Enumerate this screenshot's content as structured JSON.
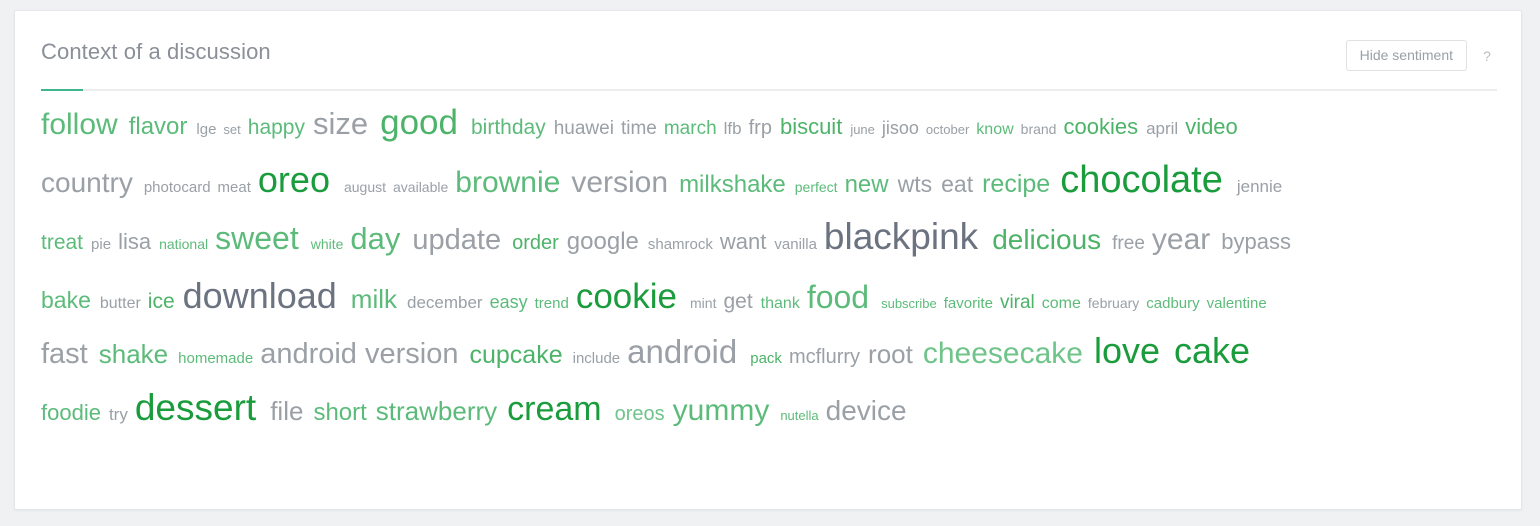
{
  "card": {
    "title": "Context of a discussion",
    "hide_sentiment_label": "Hide sentiment",
    "help_icon": "question-mark-icon",
    "help_label": "?",
    "accent_color": "#3fb68b"
  },
  "legend": {
    "positive_color": "#4caf68",
    "positive_strong_color": "#1a9c3c",
    "neutral_color": "#9aa0a6",
    "neutral_dark_color": "#6b7280"
  },
  "word_cloud": {
    "rows": [
      [
        {
          "text": "follow",
          "size": 30,
          "color": "#5cbb7a"
        },
        {
          "text": "flavor",
          "size": 24,
          "color": "#5cbb7a"
        },
        {
          "text": "lge",
          "size": 15,
          "color": "#9aa0a6"
        },
        {
          "text": "set",
          "size": 13,
          "color": "#9aa0a6"
        },
        {
          "text": "happy",
          "size": 21,
          "color": "#5cbb7a"
        },
        {
          "text": "size",
          "size": 31,
          "color": "#9aa0a6"
        },
        {
          "text": "good",
          "size": 35,
          "color": "#4cb368"
        },
        {
          "text": "birthday",
          "size": 21,
          "color": "#5cbb7a"
        },
        {
          "text": "huawei",
          "size": 19,
          "color": "#9aa0a6"
        },
        {
          "text": "time",
          "size": 19,
          "color": "#9aa0a6"
        },
        {
          "text": "march",
          "size": 19,
          "color": "#5cbb7a"
        },
        {
          "text": "lfb",
          "size": 17,
          "color": "#9aa0a6"
        },
        {
          "text": "frp",
          "size": 20,
          "color": "#9aa0a6"
        },
        {
          "text": "biscuit",
          "size": 22,
          "color": "#4cb368"
        },
        {
          "text": "june",
          "size": 13,
          "color": "#9aa0a6"
        },
        {
          "text": "jisoo",
          "size": 18,
          "color": "#9aa0a6"
        },
        {
          "text": "october",
          "size": 13,
          "color": "#9aa0a6"
        },
        {
          "text": "know",
          "size": 16,
          "color": "#5cbb7a"
        },
        {
          "text": "brand",
          "size": 14,
          "color": "#9aa0a6"
        },
        {
          "text": "cookies",
          "size": 22,
          "color": "#4cb368"
        },
        {
          "text": "april",
          "size": 17,
          "color": "#9aa0a6"
        },
        {
          "text": "video",
          "size": 22,
          "color": "#4cb368"
        }
      ],
      [
        {
          "text": "country",
          "size": 28,
          "color": "#9aa0a6"
        },
        {
          "text": "photocard",
          "size": 15,
          "color": "#9aa0a6"
        },
        {
          "text": "meat",
          "size": 15,
          "color": "#9aa0a6"
        },
        {
          "text": "oreo",
          "size": 36,
          "color": "#1a9c3c"
        },
        {
          "text": "august",
          "size": 14,
          "color": "#9aa0a6"
        },
        {
          "text": "available",
          "size": 14,
          "color": "#9aa0a6"
        },
        {
          "text": "brownie",
          "size": 30,
          "color": "#5cbb7a"
        },
        {
          "text": "version",
          "size": 30,
          "color": "#9aa0a6"
        },
        {
          "text": "milkshake",
          "size": 24,
          "color": "#5cbb7a"
        },
        {
          "text": "perfect",
          "size": 14,
          "color": "#5cbb7a"
        },
        {
          "text": "new",
          "size": 24,
          "color": "#5cbb7a"
        },
        {
          "text": "wts",
          "size": 23,
          "color": "#9aa0a6"
        },
        {
          "text": "eat",
          "size": 23,
          "color": "#9aa0a6"
        },
        {
          "text": "recipe",
          "size": 25,
          "color": "#5cbb7a"
        },
        {
          "text": "chocolate",
          "size": 38,
          "color": "#1a9c3c"
        },
        {
          "text": "jennie",
          "size": 17,
          "color": "#9aa0a6"
        }
      ],
      [
        {
          "text": "treat",
          "size": 21,
          "color": "#5cbb7a"
        },
        {
          "text": "pie",
          "size": 15,
          "color": "#9aa0a6"
        },
        {
          "text": "lisa",
          "size": 22,
          "color": "#9aa0a6"
        },
        {
          "text": "national",
          "size": 14,
          "color": "#5cbb7a"
        },
        {
          "text": "sweet",
          "size": 32,
          "color": "#5cbb7a"
        },
        {
          "text": "white",
          "size": 14,
          "color": "#5cbb7a"
        },
        {
          "text": "day",
          "size": 31,
          "color": "#5cbb7a"
        },
        {
          "text": "update",
          "size": 29,
          "color": "#9aa0a6"
        },
        {
          "text": "order",
          "size": 20,
          "color": "#4cb368"
        },
        {
          "text": "google",
          "size": 24,
          "color": "#9aa0a6"
        },
        {
          "text": "shamrock",
          "size": 15,
          "color": "#9aa0a6"
        },
        {
          "text": "want",
          "size": 22,
          "color": "#9aa0a6"
        },
        {
          "text": "vanilla",
          "size": 15,
          "color": "#9aa0a6"
        },
        {
          "text": "blackpink",
          "size": 37,
          "color": "#6b7280"
        },
        {
          "text": "delicious",
          "size": 28,
          "color": "#4cb368"
        },
        {
          "text": "free",
          "size": 19,
          "color": "#9aa0a6"
        },
        {
          "text": "year",
          "size": 30,
          "color": "#9aa0a6"
        },
        {
          "text": "bypass",
          "size": 22,
          "color": "#9aa0a6"
        }
      ],
      [
        {
          "text": "bake",
          "size": 23,
          "color": "#5cbb7a"
        },
        {
          "text": "butter",
          "size": 16,
          "color": "#9aa0a6"
        },
        {
          "text": "ice",
          "size": 21,
          "color": "#4cb368"
        },
        {
          "text": "download",
          "size": 36,
          "color": "#6b7280"
        },
        {
          "text": "milk",
          "size": 26,
          "color": "#5cbb7a"
        },
        {
          "text": "december",
          "size": 17,
          "color": "#9aa0a6"
        },
        {
          "text": "easy",
          "size": 18,
          "color": "#5cbb7a"
        },
        {
          "text": "trend",
          "size": 15,
          "color": "#5cbb7a"
        },
        {
          "text": "cookie",
          "size": 35,
          "color": "#1a9c3c"
        },
        {
          "text": "mint",
          "size": 14,
          "color": "#9aa0a6"
        },
        {
          "text": "get",
          "size": 21,
          "color": "#9aa0a6"
        },
        {
          "text": "thank",
          "size": 16,
          "color": "#5cbb7a"
        },
        {
          "text": "food",
          "size": 32,
          "color": "#5cbb7a"
        },
        {
          "text": "subscribe",
          "size": 13,
          "color": "#5cbb7a"
        },
        {
          "text": "favorite",
          "size": 15,
          "color": "#5cbb7a"
        },
        {
          "text": "viral",
          "size": 19,
          "color": "#4cb368"
        },
        {
          "text": "come",
          "size": 16,
          "color": "#5cbb7a"
        },
        {
          "text": "february",
          "size": 14,
          "color": "#9aa0a6"
        },
        {
          "text": "cadbury",
          "size": 15,
          "color": "#5cbb7a"
        },
        {
          "text": "valentine",
          "size": 15,
          "color": "#5cbb7a"
        }
      ],
      [
        {
          "text": "fast",
          "size": 29,
          "color": "#9aa0a6"
        },
        {
          "text": "shake",
          "size": 26,
          "color": "#5cbb7a"
        },
        {
          "text": "homemade",
          "size": 15,
          "color": "#5cbb7a"
        },
        {
          "text": "android version",
          "size": 29,
          "color": "#9aa0a6"
        },
        {
          "text": "cupcake",
          "size": 25,
          "color": "#4cb368"
        },
        {
          "text": "include",
          "size": 15,
          "color": "#9aa0a6"
        },
        {
          "text": "android",
          "size": 33,
          "color": "#9aa0a6"
        },
        {
          "text": "pack",
          "size": 15,
          "color": "#4cb368"
        },
        {
          "text": "mcflurry",
          "size": 20,
          "color": "#9aa0a6"
        },
        {
          "text": "root",
          "size": 26,
          "color": "#9aa0a6"
        },
        {
          "text": "cheesecake",
          "size": 30,
          "color": "#6fc48a"
        },
        {
          "text": "love",
          "size": 36,
          "color": "#1a9c3c"
        },
        {
          "text": "cake",
          "size": 36,
          "color": "#1a9c3c"
        }
      ],
      [
        {
          "text": "foodie",
          "size": 22,
          "color": "#5cbb7a"
        },
        {
          "text": "try",
          "size": 17,
          "color": "#9aa0a6"
        },
        {
          "text": "dessert",
          "size": 37,
          "color": "#1a9c3c"
        },
        {
          "text": "file",
          "size": 26,
          "color": "#9aa0a6"
        },
        {
          "text": "short",
          "size": 24,
          "color": "#5cbb7a"
        },
        {
          "text": "strawberry",
          "size": 26,
          "color": "#5cbb7a"
        },
        {
          "text": "cream",
          "size": 34,
          "color": "#1a9c3c"
        },
        {
          "text": "oreos",
          "size": 20,
          "color": "#6fc48a"
        },
        {
          "text": "yummy",
          "size": 30,
          "color": "#5cbb7a"
        },
        {
          "text": "nutella",
          "size": 13,
          "color": "#5cbb7a"
        },
        {
          "text": "device",
          "size": 28,
          "color": "#9aa0a6"
        }
      ]
    ]
  }
}
